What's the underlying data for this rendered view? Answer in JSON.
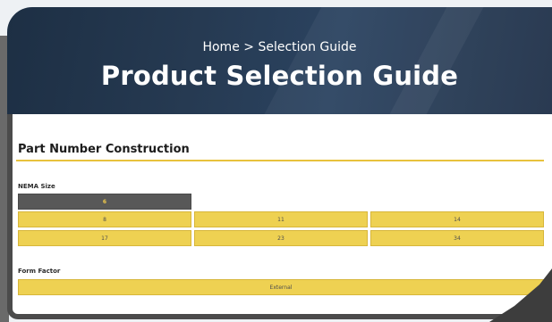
{
  "hero": {
    "breadcrumb": "Home > Selection Guide",
    "title": "Product Selection Guide"
  },
  "section": {
    "title": "Part Number Construction"
  },
  "nema": {
    "label": "NEMA Size",
    "selected": "6",
    "options": [
      "8",
      "11",
      "14",
      "17",
      "23",
      "34"
    ]
  },
  "form_factor": {
    "label": "Form Factor",
    "options": [
      "External"
    ]
  },
  "colors": {
    "accent": "#eed152",
    "selected_bg": "#585858",
    "selected_text": "#f0c94b",
    "hero_bg": "#263a52"
  }
}
